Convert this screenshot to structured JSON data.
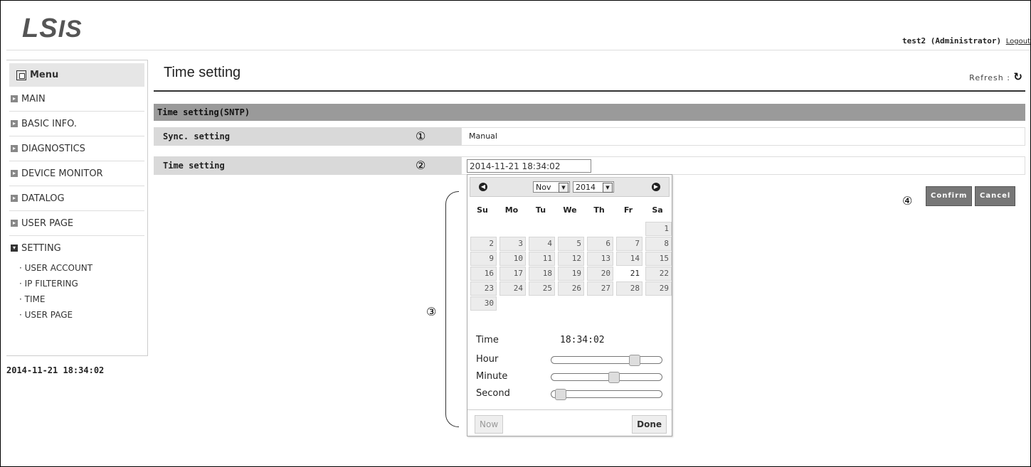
{
  "header": {
    "logo_ls": "LS",
    "logo_is": "IS",
    "user": "test2 (Administrator)",
    "logout": "Logout"
  },
  "sidebar": {
    "menu_title": "Menu",
    "items": [
      "MAIN",
      "BASIC INFO.",
      "DIAGNOSTICS",
      "DEVICE MONITOR",
      "DATALOG",
      "USER PAGE"
    ],
    "open_item": "SETTING",
    "sub_items": [
      "· USER ACCOUNT",
      "· IP FILTERING",
      "· TIME",
      "· USER PAGE"
    ],
    "datetime": "2014-11-21 18:34:02"
  },
  "main": {
    "title": "Time setting",
    "refresh_label": "Refresh :",
    "section": "Time setting(SNTP)",
    "rows": [
      {
        "label": "Sync. setting",
        "value": "Manual",
        "marker": "①"
      },
      {
        "label": "Time setting",
        "value": "2014-11-21 18:34:02",
        "marker": "②"
      }
    ],
    "confirm": "Confirm",
    "cancel": "Cancel",
    "marker3": "③",
    "marker4": "④"
  },
  "datepicker": {
    "month": "Nov",
    "year": "2014",
    "dow": [
      "Su",
      "Mo",
      "Tu",
      "We",
      "Th",
      "Fr",
      "Sa"
    ],
    "days": [
      "1",
      "2",
      "3",
      "4",
      "5",
      "6",
      "7",
      "8",
      "9",
      "10",
      "11",
      "12",
      "13",
      "14",
      "15",
      "16",
      "17",
      "18",
      "19",
      "20",
      "21",
      "22",
      "23",
      "24",
      "25",
      "26",
      "27",
      "28",
      "29",
      "30"
    ],
    "today": "21",
    "time_label": "Time",
    "time_value": "18:34:02",
    "hour_label": "Hour",
    "minute_label": "Minute",
    "second_label": "Second",
    "hour": 18,
    "minute": 34,
    "second": 2,
    "now_label": "Now",
    "done_label": "Done"
  }
}
